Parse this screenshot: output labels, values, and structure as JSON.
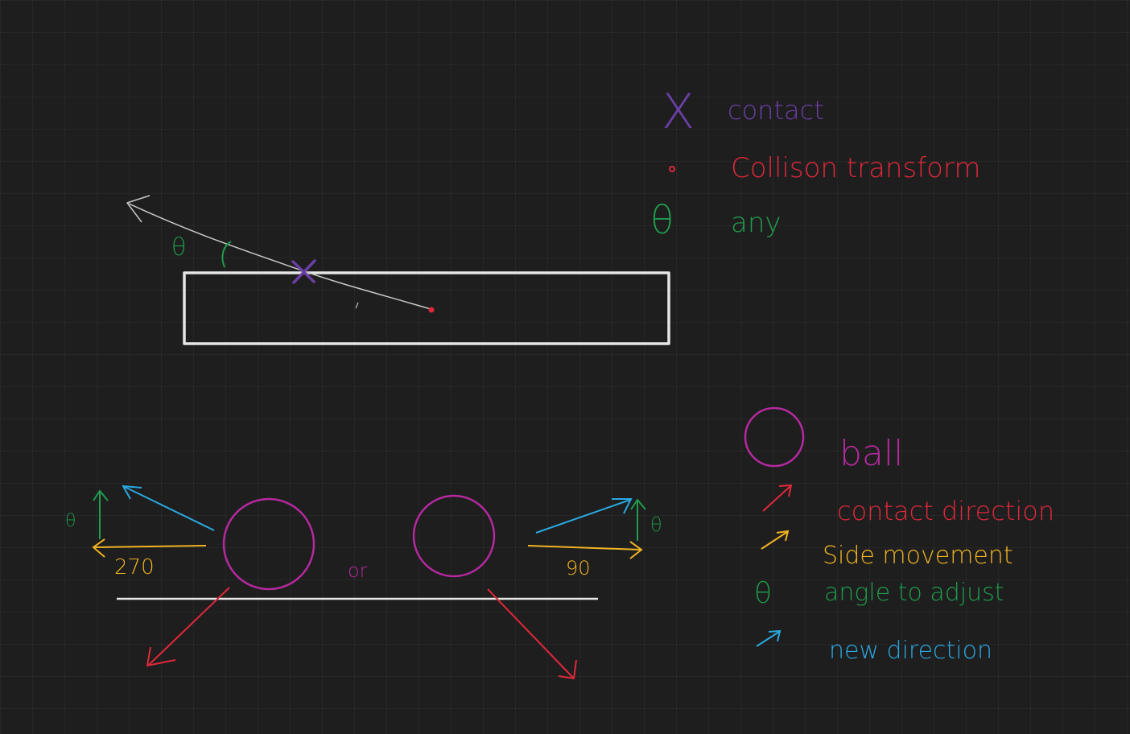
{
  "colors": {
    "background": "#1e1e1e",
    "grid": "#2d2d2d",
    "grid_dot": "#3a3a3a",
    "white": "#e6e6e6",
    "gray": "#c8c8c8",
    "purple": "#6a3fa6",
    "red": "#e0283a",
    "green": "#1f9c4d",
    "magenta": "#b5299f",
    "orange": "#f0b323",
    "blue": "#2aa8e0"
  },
  "legend_top": {
    "contact_symbol": "X",
    "contact_label": "contact",
    "collision_label": "Collison transform",
    "angle_symbol": "θ",
    "angle_label": "any"
  },
  "top_diagram": {
    "theta_label": "θ"
  },
  "bottom_diagram": {
    "left_theta": "θ",
    "left_angle": "270",
    "middle_label": "or",
    "right_angle": "90",
    "right_theta": "θ"
  },
  "legend_bottom": {
    "ball_label": "ball",
    "contact_direction_label": "contact direction",
    "side_movement_label": "Side movement",
    "angle_symbol": "θ",
    "angle_adjust_label": "angle to adjust",
    "new_direction_label": "new direction"
  }
}
